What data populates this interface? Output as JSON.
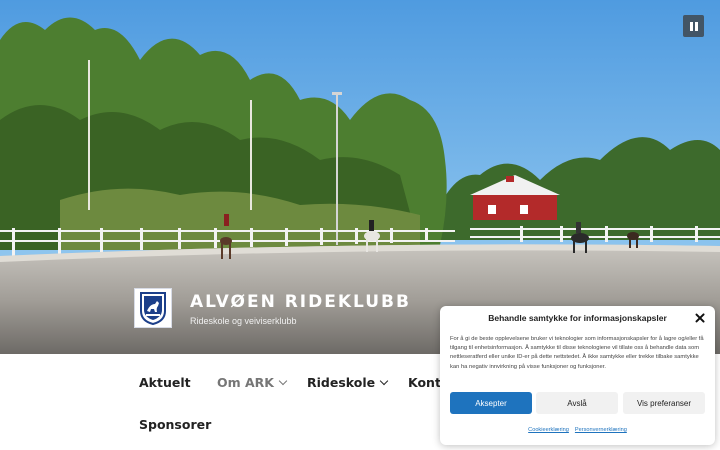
{
  "site": {
    "title": "ALVØEN RIDEKLUBB",
    "description": "Rideskole og veiviserklubb"
  },
  "hero": {
    "pause_icon": "pause-icon"
  },
  "nav": {
    "items": [
      {
        "label": "Aktuelt",
        "has_submenu": false,
        "active": false
      },
      {
        "label": "Om ARK",
        "has_submenu": true,
        "active": true
      },
      {
        "label": "Rideskole",
        "has_submenu": true,
        "active": false
      },
      {
        "label": "Konta",
        "has_submenu": false,
        "active": false
      },
      {
        "label": "Sponsorer",
        "has_submenu": false,
        "active": false
      }
    ]
  },
  "consent": {
    "title": "Behandle samtykke for informasjonskapsler",
    "text": "For å gi de beste opplevelsene bruker vi teknologier som informasjonskapsler for å lagre og/eller få tilgang til enhetsinformasjon. Å samtykke til disse teknologiene vil tillate oss å behandle data som nettleseratferd eller unike ID-er på dette nettstedet. Å ikke samtykke eller trekke tilbake samtykke kan ha negativ innvirkning på visse funksjoner og funksjoner.",
    "accept_label": "Aksepter",
    "deny_label": "Avslå",
    "prefs_label": "Vis preferanser",
    "links": [
      "Cookieerklæring",
      "Personvernerklæring"
    ],
    "accent_color": "#1e73be"
  }
}
